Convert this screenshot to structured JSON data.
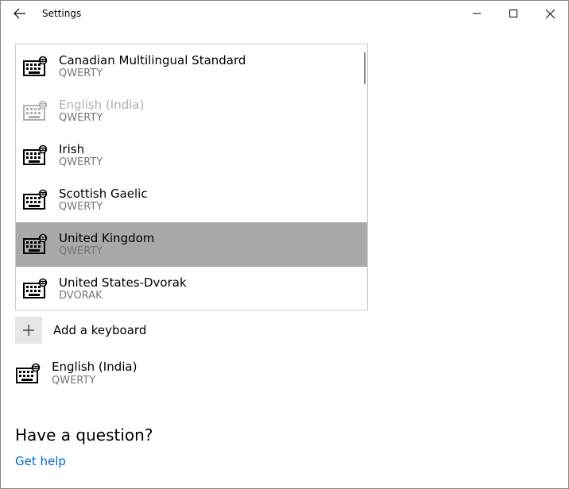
{
  "window": {
    "title": "Settings"
  },
  "keyboards": [
    {
      "name": "Canadian Multilingual Standard",
      "layout": "QWERTY",
      "state": "normal"
    },
    {
      "name": "English (India)",
      "layout": "QWERTY",
      "state": "dimmed"
    },
    {
      "name": "Irish",
      "layout": "QWERTY",
      "state": "normal"
    },
    {
      "name": "Scottish Gaelic",
      "layout": "QWERTY",
      "state": "normal"
    },
    {
      "name": "United Kingdom",
      "layout": "QWERTY",
      "state": "selected"
    },
    {
      "name": "United States-Dvorak",
      "layout": "DVORAK",
      "state": "normal"
    }
  ],
  "addKeyboard": {
    "label": "Add a keyboard"
  },
  "installed": {
    "name": "English (India)",
    "layout": "QWERTY"
  },
  "footer": {
    "question": "Have a question?",
    "help": "Get help"
  }
}
